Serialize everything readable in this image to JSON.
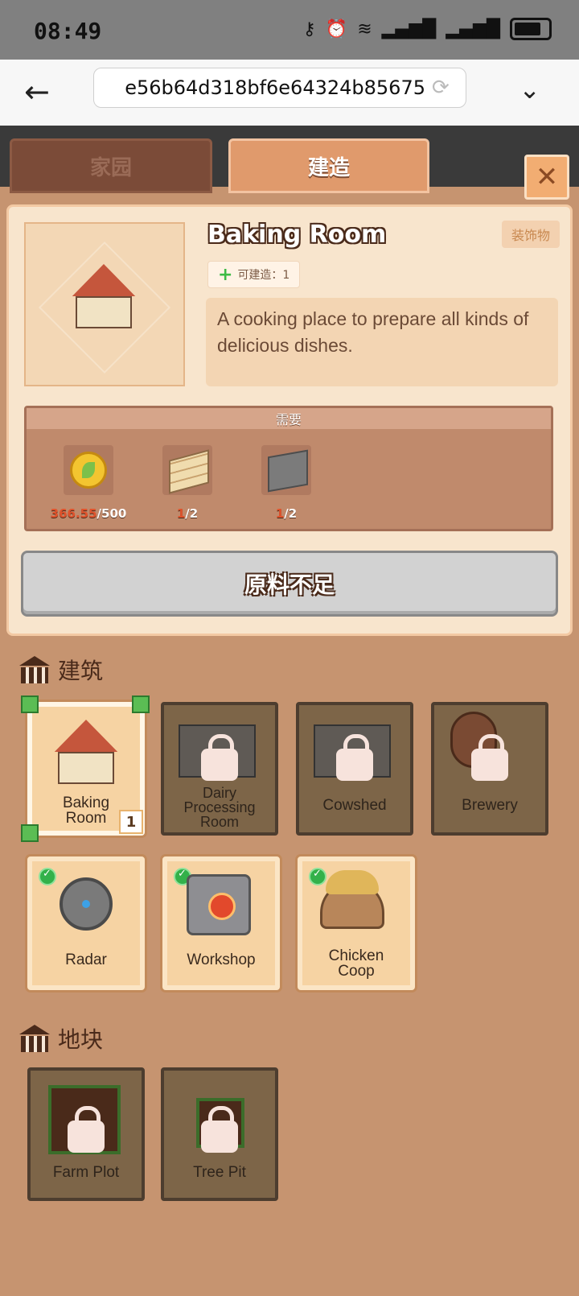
{
  "status_bar": {
    "time": "08:49"
  },
  "browser": {
    "url": "e56b64d318bf6e64324b85675"
  },
  "tabs": [
    {
      "label": "家园"
    },
    {
      "label": "建造"
    }
  ],
  "detail": {
    "title": "Baking Room",
    "category": "装饰物",
    "buildable_label": "可建造：1",
    "description": "A cooking place to prepare all kinds of delicious dishes.",
    "requirement_header": "需要",
    "resources": [
      {
        "icon": "gold-coin-icon",
        "have": "366.55",
        "need": "/500"
      },
      {
        "icon": "wood-planks-icon",
        "have": "1",
        "need": "/2"
      },
      {
        "icon": "stone-block-icon",
        "have": "1",
        "need": "/2"
      }
    ],
    "action_button": "原料不足"
  },
  "sections": {
    "buildings": {
      "title": "建筑",
      "items": [
        {
          "label_1": "Baking",
          "label_2": "Room",
          "state": "selected",
          "count": "1"
        },
        {
          "label_1": "Dairy",
          "label_2": "Processing",
          "label_3": "Room",
          "state": "locked"
        },
        {
          "label_1": "Cowshed",
          "state": "locked"
        },
        {
          "label_1": "Brewery",
          "state": "locked"
        },
        {
          "label_1": "Radar",
          "state": "owned"
        },
        {
          "label_1": "Workshop",
          "state": "owned"
        },
        {
          "label_1": "Chicken",
          "label_2": "Coop",
          "state": "owned"
        }
      ]
    },
    "plots": {
      "title": "地块",
      "items": [
        {
          "label_1": "Farm Plot",
          "state": "locked"
        },
        {
          "label_1": "Tree Pit",
          "state": "locked"
        }
      ]
    }
  }
}
